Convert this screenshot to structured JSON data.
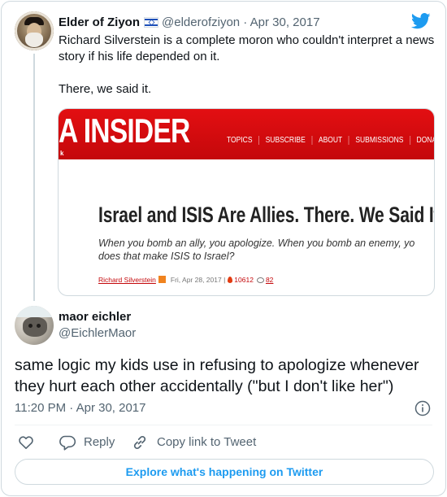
{
  "parent_tweet": {
    "author_name": "Elder of Ziyon",
    "flag": "israel-flag",
    "handle": "@elderofziyon",
    "separator": "·",
    "date": "Apr 30, 2017",
    "text_lines": [
      "Richard Silverstein is a complete moron who couldn't interpret a news story if his life depended on it.",
      "There, we said it."
    ],
    "embedded_image": {
      "banner_logo": "A INSIDER",
      "banner_mini": "k",
      "nav": [
        "TOPICS",
        "SUBSCRIBE",
        "ABOUT",
        "SUBMISSIONS",
        "DONAT"
      ],
      "headline": "Israel and ISIS Are Allies. There. We Said It.",
      "subhead_lines": [
        "When you bomb an ally, you apologize. When you bomb an enemy, yo",
        "does that make ISIS to Israel?"
      ],
      "author": "Richard Silverstein",
      "date": "Fri, Apr 28, 2017 |",
      "views": "10612",
      "comments": "82"
    }
  },
  "main_tweet": {
    "author_name": "maor eichler",
    "handle": "@EichlerMaor",
    "text": "same logic my kids use in refusing to apologize whenever they hurt each other accidentally (\"but I don't like her\")",
    "timestamp": "11:20 PM · Apr 30, 2017"
  },
  "actions": {
    "reply_label": "Reply",
    "copy_label": "Copy link to Tweet"
  },
  "explore_label": "Explore what's happening on Twitter",
  "colors": {
    "twitter_blue": "#1d9bf0",
    "text": "#0f1419",
    "secondary": "#536471",
    "border": "#cfd9de",
    "banner_red": "#d10a0d"
  }
}
